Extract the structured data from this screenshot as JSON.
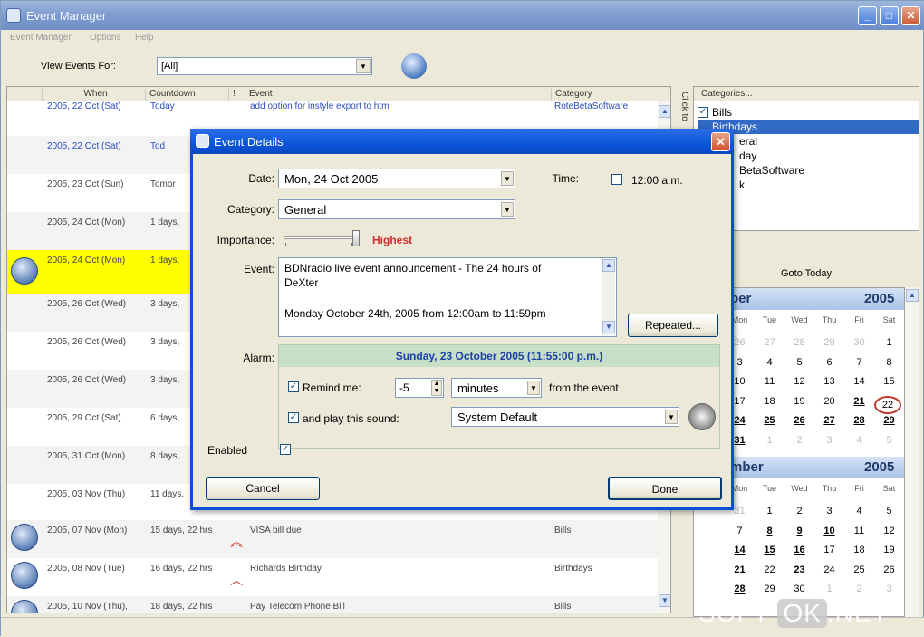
{
  "window": {
    "title": "Event Manager"
  },
  "menu": [
    "Event Manager",
    "Options",
    "Help"
  ],
  "toolbar": {
    "view_label": "View Events For:",
    "view_value": "[All]"
  },
  "grid": {
    "columns": [
      "When",
      "Countdown",
      "!",
      "Event",
      "Category"
    ],
    "rows": [
      {
        "when": "2005, 22 Oct (Sat)",
        "countdown": "Today",
        "event": "add option for instyle export to html",
        "category": "RoteBetaSoftware"
      },
      {
        "when": "2005, 22 Oct (Sat)",
        "countdown": "Tod",
        "event": "",
        "category": ""
      },
      {
        "when": "2005, 23 Oct (Sun)",
        "countdown": "Tomor",
        "event": "",
        "category": ""
      },
      {
        "when": "2005, 24 Oct (Mon)",
        "countdown": "1 days,",
        "event": "",
        "category": ""
      },
      {
        "when": "2005, 24 Oct (Mon)",
        "countdown": "1 days,",
        "event": "",
        "category": ""
      },
      {
        "when": "2005, 26 Oct (Wed)",
        "countdown": "3 days,",
        "event": "",
        "category": ""
      },
      {
        "when": "2005, 26 Oct (Wed)",
        "countdown": "3 days,",
        "event": "",
        "category": ""
      },
      {
        "when": "2005, 26 Oct (Wed)",
        "countdown": "3 days,",
        "event": "",
        "category": ""
      },
      {
        "when": "2005, 29 Oct (Sat)",
        "countdown": "6 days,",
        "event": "",
        "category": ""
      },
      {
        "when": "2005, 31 Oct (Mon)",
        "countdown": "8 days,",
        "event": "",
        "category": ""
      },
      {
        "when": "2005, 03 Nov (Thu)",
        "countdown": "11 days,",
        "event": "",
        "category": ""
      },
      {
        "when": "2005, 07 Nov (Mon)",
        "countdown": "15 days, 22 hrs",
        "event": "VISA bill due",
        "category": "Bills"
      },
      {
        "when": "2005, 08 Nov (Tue)",
        "countdown": "16 days, 22 hrs",
        "event": "Richards Birthday",
        "category": "Birthdays"
      },
      {
        "when": "2005, 10 Nov (Thu),",
        "countdown": "18 days, 22 hrs",
        "event": "Pay Telecom Phone Bill",
        "category": "Bills"
      }
    ],
    "side_tab": "Click to"
  },
  "categories": {
    "header": "Categories...",
    "items": [
      "Bills",
      "Birthdays",
      "eral",
      "day",
      "BetaSoftware",
      "k"
    ]
  },
  "calendar": {
    "goto_label": "Goto Today",
    "dow": [
      "Mon",
      "Tue",
      "Wed",
      "Thu",
      "Fri",
      "Sat"
    ],
    "month1": {
      "name": "ber",
      "year": "2005",
      "weeks": [
        [
          "26",
          "27",
          "28",
          "29",
          "30",
          "1"
        ],
        [
          "3",
          "4",
          "5",
          "6",
          "7",
          "8"
        ],
        [
          "10",
          "11",
          "12",
          "13",
          "14",
          "15"
        ],
        [
          "17",
          "18",
          "19",
          "20",
          "21",
          "22"
        ],
        [
          "24",
          "25",
          "26",
          "27",
          "28",
          "29"
        ],
        [
          "31",
          "1",
          "2",
          "3",
          "4",
          "5"
        ]
      ]
    },
    "month2": {
      "name": "mber",
      "year": "2005",
      "weeks": [
        [
          "31",
          "1",
          "2",
          "3",
          "4",
          "5"
        ],
        [
          "7",
          "8",
          "9",
          "10",
          "11",
          "12"
        ],
        [
          "14",
          "15",
          "16",
          "17",
          "18",
          "19"
        ],
        [
          "21",
          "22",
          "23",
          "24",
          "25",
          "26"
        ],
        [
          "28",
          "29",
          "30",
          "1",
          "2",
          "3"
        ]
      ]
    }
  },
  "dialog": {
    "title": "Event Details",
    "date_label": "Date:",
    "date_value": "Mon, 24 Oct 2005",
    "time_label": "Time:",
    "time_value": "12:00 a.m.",
    "category_label": "Category:",
    "category_value": "General",
    "importance_label": "Importance:",
    "importance_value": "Highest",
    "event_label": "Event:",
    "event_line1": "BDNradio live event announcement - The 24 hours of",
    "event_line2": "DeXter",
    "event_line3": "Monday October 24th, 2005 from 12:00am to 11:59pm",
    "repeated_label": "Repeated...",
    "alarm_label": "Alarm:",
    "alarm_date": "Sunday, 23 October 2005 (11:55:00 p.m.)",
    "remind_label": "Remind me:",
    "remind_value": "-5",
    "remind_unit": "minutes",
    "from_event": "from the event",
    "sound_label": "and play this sound:",
    "sound_value": "System Default",
    "enabled_label": "Enabled",
    "cancel_label": "Cancel",
    "done_label": "Done"
  },
  "watermark": {
    "left": "SOFT-",
    "box": "OK",
    "right": ".NET"
  },
  "colors": {
    "accent": "#0a4fd6",
    "highlight_row": "#ffff00",
    "importance": "#d03030",
    "alarm_header": "#c6dfc6"
  }
}
